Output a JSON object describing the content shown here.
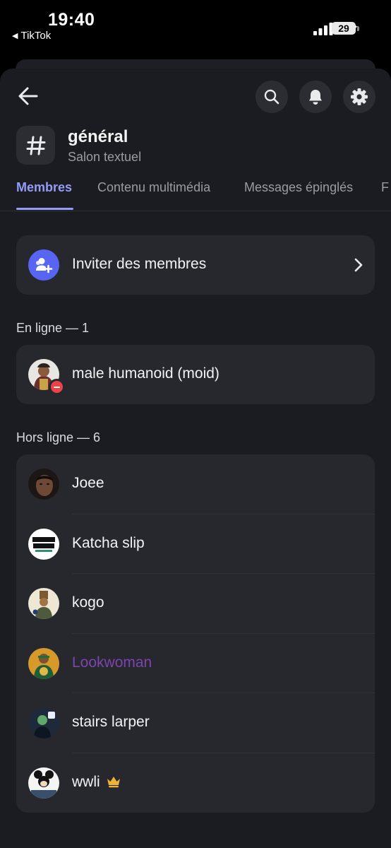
{
  "status_bar": {
    "time": "19:40",
    "back_app": "TikTok",
    "battery": "29",
    "icons": [
      "signal-icon",
      "wifi-icon",
      "battery-icon"
    ]
  },
  "header": {
    "channel_name": "général",
    "channel_type": "Salon textuel",
    "icons": [
      "back-arrow-icon",
      "search-icon",
      "bell-icon",
      "gear-icon",
      "hashtag-icon"
    ]
  },
  "tabs": [
    {
      "label": "Membres",
      "active": true
    },
    {
      "label": "Contenu multimédia",
      "active": false
    },
    {
      "label": "Messages épinglés",
      "active": false
    },
    {
      "label": "F",
      "active": false
    }
  ],
  "invite": {
    "label": "Inviter des membres",
    "icon": "add-members-icon"
  },
  "online": {
    "title": "En ligne — 1",
    "members": [
      {
        "name": "male humanoid (moid)",
        "status": "dnd",
        "color": "#f2f3f5"
      }
    ]
  },
  "offline": {
    "title": "Hors ligne — 6",
    "members": [
      {
        "name": "Joee",
        "color": "#f2f3f5"
      },
      {
        "name": "Katcha slip",
        "color": "#f2f3f5"
      },
      {
        "name": "kogo",
        "color": "#f2f3f5"
      },
      {
        "name": "Lookwoman",
        "color": "#7d44b0"
      },
      {
        "name": "stairs larper",
        "color": "#f2f3f5"
      },
      {
        "name": "wwli",
        "color": "#f2f3f5",
        "badge": "crown-icon"
      }
    ]
  },
  "colors": {
    "accent": "#949cf7",
    "blurple": "#5865f2",
    "background": "#1b1c21",
    "card": "#26282e",
    "dnd": "#ed4245",
    "crown": "#f0b232"
  }
}
